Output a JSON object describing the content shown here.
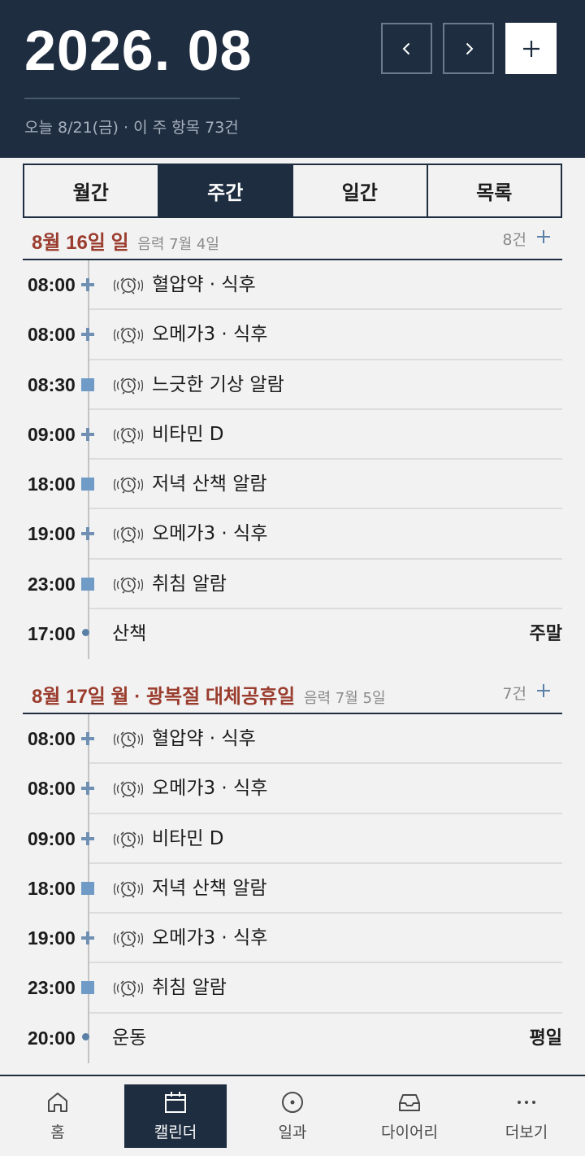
{
  "header": {
    "month": "2026. 08",
    "today_line": "오늘 8/21(금) · 이 주 항목 73건",
    "prev_icon": "chevron-left-icon",
    "next_icon": "chevron-right-icon",
    "add_icon": "plus-icon"
  },
  "tabs": [
    {
      "label": "월간",
      "active": false
    },
    {
      "label": "주간",
      "active": true
    },
    {
      "label": "일간",
      "active": false
    },
    {
      "label": "목록",
      "active": false
    }
  ],
  "days": [
    {
      "title": "8월 16일 일",
      "lunar": "음력 7월 4일",
      "count": "8건",
      "items": [
        {
          "time": "08:00",
          "marker": "cross",
          "alarm": true,
          "label": "혈압약 · 식후",
          "tag": ""
        },
        {
          "time": "08:00",
          "marker": "cross",
          "alarm": true,
          "label": "오메가3 · 식후",
          "tag": ""
        },
        {
          "time": "08:30",
          "marker": "square",
          "alarm": true,
          "label": "느긋한 기상 알람",
          "tag": ""
        },
        {
          "time": "09:00",
          "marker": "cross",
          "alarm": true,
          "label": "비타민 D",
          "tag": ""
        },
        {
          "time": "18:00",
          "marker": "square",
          "alarm": true,
          "label": "저녁 산책 알람",
          "tag": ""
        },
        {
          "time": "19:00",
          "marker": "cross",
          "alarm": true,
          "label": "오메가3 · 식후",
          "tag": ""
        },
        {
          "time": "23:00",
          "marker": "square",
          "alarm": true,
          "label": "취침 알람",
          "tag": ""
        },
        {
          "time": "17:00",
          "marker": "dot",
          "alarm": false,
          "label": "산책",
          "tag": "주말"
        }
      ]
    },
    {
      "title": "8월 17일 월 · 광복절 대체공휴일",
      "lunar": "음력 7월 5일",
      "count": "7건",
      "items": [
        {
          "time": "08:00",
          "marker": "cross",
          "alarm": true,
          "label": "혈압약 · 식후",
          "tag": ""
        },
        {
          "time": "08:00",
          "marker": "cross",
          "alarm": true,
          "label": "오메가3 · 식후",
          "tag": ""
        },
        {
          "time": "09:00",
          "marker": "cross",
          "alarm": true,
          "label": "비타민 D",
          "tag": ""
        },
        {
          "time": "18:00",
          "marker": "square",
          "alarm": true,
          "label": "저녁 산책 알람",
          "tag": ""
        },
        {
          "time": "19:00",
          "marker": "cross",
          "alarm": true,
          "label": "오메가3 · 식후",
          "tag": ""
        },
        {
          "time": "23:00",
          "marker": "square",
          "alarm": true,
          "label": "취침 알람",
          "tag": ""
        },
        {
          "time": "20:00",
          "marker": "dot",
          "alarm": false,
          "label": "운동",
          "tag": "평일"
        }
      ]
    }
  ],
  "bottom_nav": [
    {
      "label": "홈",
      "icon": "home-icon",
      "active": false
    },
    {
      "label": "캘린더",
      "icon": "calendar-icon",
      "active": true
    },
    {
      "label": "일과",
      "icon": "routine-icon",
      "active": false
    },
    {
      "label": "다이어리",
      "icon": "inbox-icon",
      "active": false
    },
    {
      "label": "더보기",
      "icon": "more-icon",
      "active": false
    }
  ],
  "colors": {
    "navy": "#1e2d40",
    "holiday_red": "#9a3c2e",
    "marker_blue": "#6f9bc6",
    "background": "#f2f2f2"
  }
}
